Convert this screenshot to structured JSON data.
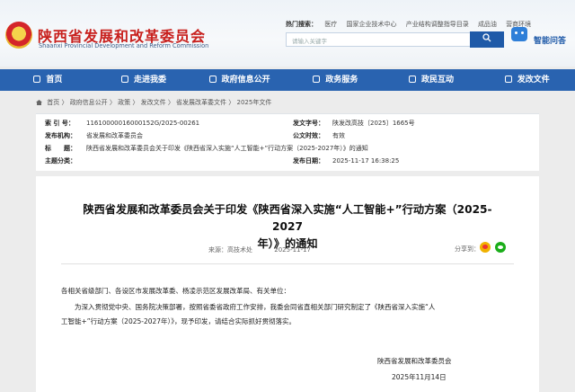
{
  "header": {
    "title": "陕西省发展和改革委员会",
    "subtitle": "Shaanxi Provincial Development and Reform Commission",
    "hot_label": "热门搜索：",
    "hot_terms": [
      "医疗",
      "国家企业技术中心",
      "产业结构调整指导目录",
      "成品油",
      "营商环境"
    ],
    "search_placeholder": "请输入关键字",
    "search_icon": "search-icon",
    "assistant_label": "智能问答"
  },
  "nav": {
    "items": [
      {
        "label": "首页",
        "icon": "home-icon"
      },
      {
        "label": "走进我委",
        "icon": "people-icon"
      },
      {
        "label": "政府信息公开",
        "icon": "document-icon"
      },
      {
        "label": "政务服务",
        "icon": "service-icon"
      },
      {
        "label": "政民互动",
        "icon": "chat-icon"
      },
      {
        "label": "发改文件",
        "icon": "file-icon"
      }
    ]
  },
  "breadcrumb": [
    "首页",
    "政府信息公开",
    "政策",
    "发改文件",
    "省发展改革委文件",
    "2025年文件"
  ],
  "meta": {
    "index_label": "索 引 号：",
    "index_value": "11610000016000152G/2025-00261",
    "doc_no_label": "发文字号：",
    "doc_no_value": "陕发改高技〔2025〕1665号",
    "issuer_label": "发布机构：",
    "issuer_value": "省发展和改革委员会",
    "validity_label": "公文时效：",
    "validity_value": "有效",
    "title_label": "标　　题：",
    "title_value": "陕西省发展和改革委员会关于印发《陕西省深入实施“人工智能+”行动方案（2025-2027年）》的通知",
    "topic_label": "主题分类：",
    "topic_value": "",
    "date_label": "发布日期：",
    "date_value": "2025-11-17 16:38:25"
  },
  "article": {
    "title_line1": "陕西省发展和改革委员会关于印发《陕西省深入实施“人工智能+”行动方案（2025-2027",
    "title_line2": "年）》的通知",
    "source": "来源：高技术处",
    "date": "2025-11-17",
    "share_label": "分享到：",
    "body_salutation": "各相关省级部门、各设区市发展改革委、杨凌示范区发展改革局、有关单位：",
    "body_p1_line1": "为深入贯彻党中央、国务院决策部署，按照省委省政府工作安排，我委会同省直相关部门研究制定了《陕西省深入实施“人",
    "body_p1_line2": "工智能+”行动方案（2025-2027年）》，现予印发，请结合实际抓好贯彻落实。",
    "signature": "陕西省发展和改革委员会",
    "sign_date": "2025年11月14日"
  },
  "colors": {
    "brand_red": "#c8201d",
    "nav_blue": "#2963b0"
  }
}
